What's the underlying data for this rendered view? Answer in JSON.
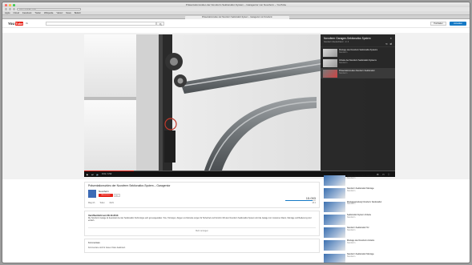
{
  "window": {
    "title": "Präsentationsvideo der Novoferm Sektionaltor-System – Garagentor von Novoferm – YouTube",
    "traffic_lights": [
      "#fc605c",
      "#fdbc40",
      "#34c84a"
    ]
  },
  "browser": {
    "url": "www.youtube.com",
    "bookmarks": [
      "Apple",
      "iCloud",
      "Facebook",
      "Twitter",
      "Wikipedia",
      "Yahoo!",
      "News",
      "Beliebt"
    ],
    "tab_title": "Präsentationsvideo der Novoferm Sektionaltor-System – Garagentor von Novoferm"
  },
  "youtube": {
    "logo_you": "You",
    "logo_tube": "Tube",
    "lang": "DE",
    "upload_label": "Hochladen",
    "signin_label": "Anmelden",
    "accent": "#e62117",
    "link_blue": "#167ac6"
  },
  "player": {
    "progress": 0.16,
    "time": "0:31 / 1:52"
  },
  "playlist": {
    "title": "Novoferm Garagen-Sektionaltor-System",
    "subtitle": "Novoferm Deutschland · 1 / 3",
    "items": [
      {
        "title": "Montage des Novoferm Sektionaltor-Systems",
        "channel": "Novoferm"
      },
      {
        "title": "Vorteile des Novoferm Sektionaltor-Systems",
        "channel": "Novoferm"
      },
      {
        "title": "Präsentationsvideo Novoferm Sektionaltor",
        "channel": "Novoferm"
      }
    ]
  },
  "video": {
    "title": "Präsentationsvideo der Novoferm Sektionaltor-System – Garagentor",
    "channel": "Novoferm",
    "subscribe_label": "Abonnieren",
    "subscribers": "312",
    "views": "15.093",
    "like_ratio": 0.9,
    "likes": "13   2",
    "actions": [
      "Mag ich",
      "Teilen",
      "Mehr"
    ],
    "published": "Veröffentlicht am 08.10.2013",
    "description": "Die Novoferm Garage ist besonders bei der Sektionaltor-Technologie sehr gut ausgestattet. Tore, Torzargen, Zargen und Antriebe sorgen für Sicherheit und Komfort. Mit dem Novoferm Sektionaltor-System wird die Garage zum modernen Raum, Montage und Bedienung sind einfach.",
    "show_more": "Mehr anzeigen"
  },
  "comments": {
    "heading": "Kommentare",
    "note": "Kommentare sind für dieses Video deaktiviert."
  },
  "sidebar": [
    {
      "title": "Vorteile des Novoferm Sektionaltor-Systems",
      "channel": "Novoferm"
    },
    {
      "title": "Novoferm Sektionaltor Montage",
      "channel": "Novoferm"
    },
    {
      "title": "Montageanleitung Novoferm Sektionaltor",
      "channel": "Novoferm"
    },
    {
      "title": "Sektionaltor-System Vorteile",
      "channel": "Novoferm"
    },
    {
      "title": "Novoferm Sektionaltor Tor",
      "channel": "Novoferm"
    },
    {
      "title": "Montage des Novoferm Antriebs",
      "channel": "Novoferm"
    },
    {
      "title": "Novoferm Sektionaltor Montage",
      "channel": "Novoferm"
    }
  ]
}
